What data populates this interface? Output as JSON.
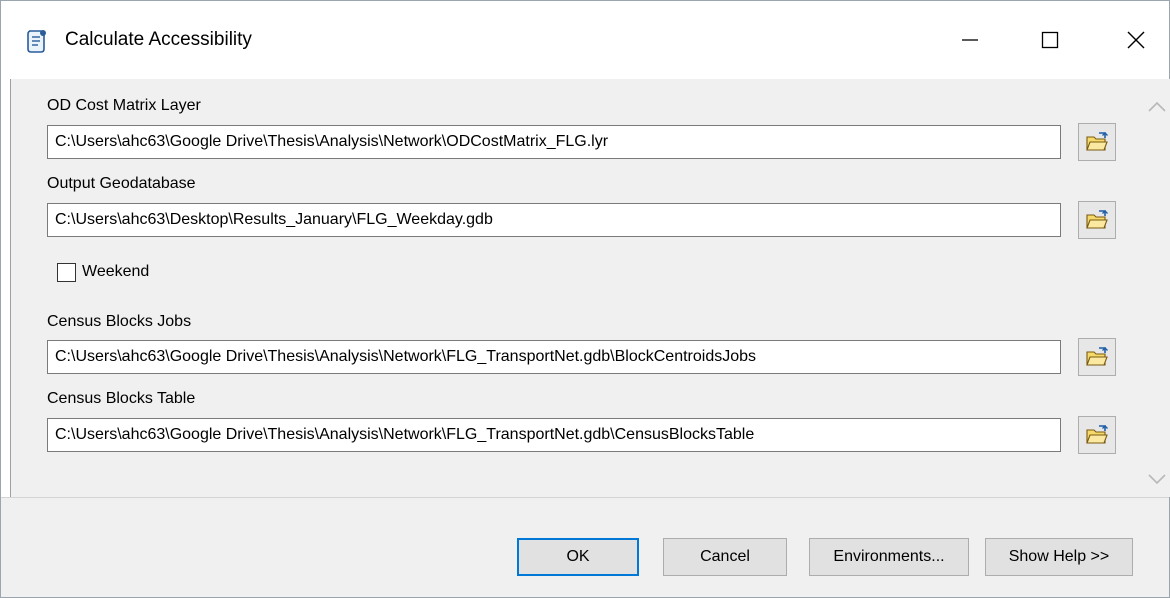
{
  "window": {
    "title": "Calculate Accessibility",
    "icon": "script-tool-icon",
    "controls": [
      "minimize-icon",
      "maximize-icon",
      "close-icon"
    ]
  },
  "fields": [
    {
      "label": "OD Cost Matrix Layer",
      "value": "C:\\Users\\ahc63\\Google Drive\\Thesis\\Analysis\\Network\\ODCostMatrix_FLG.lyr"
    },
    {
      "label": "Output Geodatabase",
      "value": "C:\\Users\\ahc63\\Desktop\\Results_January\\FLG_Weekday.gdb"
    },
    {
      "label": "Census Blocks Jobs",
      "value": "C:\\Users\\ahc63\\Google Drive\\Thesis\\Analysis\\Network\\FLG_TransportNet.gdb\\BlockCentroidsJobs"
    },
    {
      "label": "Census Blocks Table",
      "value": "C:\\Users\\ahc63\\Google Drive\\Thesis\\Analysis\\Network\\FLG_TransportNet.gdb\\CensusBlocksTable"
    }
  ],
  "weekend": {
    "label": "Weekend",
    "checked": false
  },
  "buttons": {
    "ok": "OK",
    "cancel": "Cancel",
    "environments": "Environments...",
    "help": "Show Help >>"
  },
  "colors": {
    "focus_border": "#0078d7",
    "folder": "#f5d96b"
  }
}
